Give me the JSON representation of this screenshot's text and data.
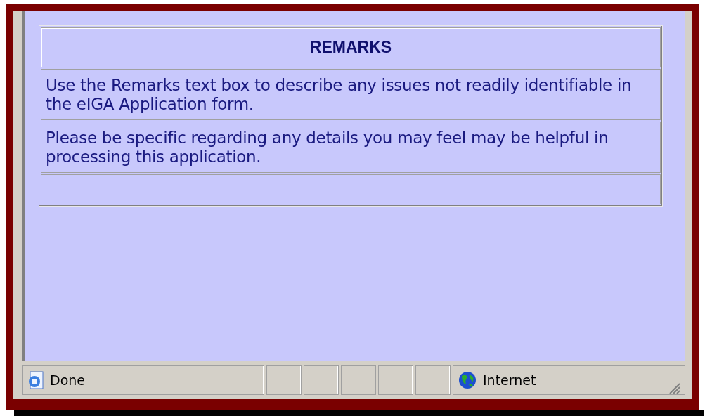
{
  "table": {
    "heading": "REMARKS",
    "rows": [
      "Use the Remarks text box to describe any issues not readily identifiable in the eIGA Application form.",
      "Please be specific regarding any details you may feel may be helpful in processing this application."
    ]
  },
  "status_bar": {
    "status": "Done",
    "zone": "Internet"
  }
}
